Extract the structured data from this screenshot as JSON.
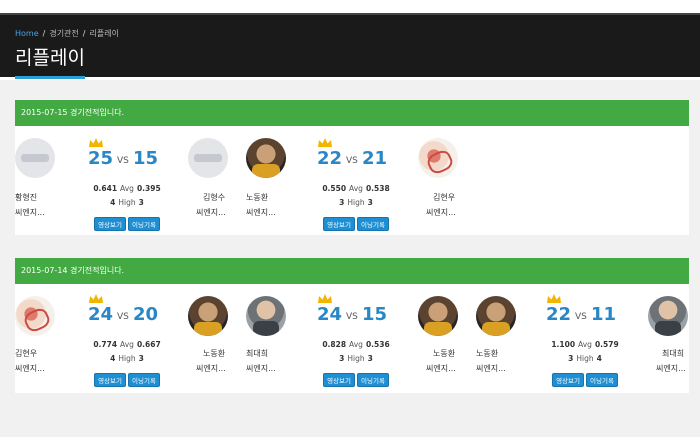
{
  "breadcrumb": [
    "Home",
    "경기관전",
    "리플레이"
  ],
  "page_title": "리플레이",
  "sections": [
    {
      "date_label": "2015-07-15 경기전적입니다.",
      "matches": [
        {
          "left": {
            "name": "황형진",
            "team": "씨엔지..."
          },
          "right": {
            "name": "김형수",
            "team": "씨엔지..."
          },
          "score_left": "25",
          "score_right": "15",
          "avg_left": "0.641",
          "avg_right": "0.395",
          "high_left": "4",
          "high_right": "3",
          "winner": "left"
        },
        {
          "left": {
            "name": "노동환",
            "team": "씨엔지..."
          },
          "right": {
            "name": "김현우",
            "team": "씨엔지..."
          },
          "score_left": "22",
          "score_right": "21",
          "avg_left": "0.550",
          "avg_right": "0.538",
          "high_left": "3",
          "high_right": "3",
          "winner": "left"
        }
      ]
    },
    {
      "date_label": "2015-07-14 경기전적입니다.",
      "matches": [
        {
          "left": {
            "name": "김현우",
            "team": "씨엔지..."
          },
          "right": {
            "name": "노동환",
            "team": "씨엔지..."
          },
          "score_left": "24",
          "score_right": "20",
          "avg_left": "0.774",
          "avg_right": "0.667",
          "high_left": "4",
          "high_right": "3",
          "winner": "left"
        },
        {
          "left": {
            "name": "최대희",
            "team": "씨엔지..."
          },
          "right": {
            "name": "노동환",
            "team": "씨엔지..."
          },
          "score_left": "24",
          "score_right": "15",
          "avg_left": "0.828",
          "avg_right": "0.536",
          "high_left": "3",
          "high_right": "3",
          "winner": "left"
        },
        {
          "left": {
            "name": "노동환",
            "team": "씨엔지..."
          },
          "right": {
            "name": "최대희",
            "team": "씨엔지..."
          },
          "score_left": "22",
          "score_right": "11",
          "avg_left": "1.100",
          "avg_right": "0.579",
          "high_left": "3",
          "high_right": "4",
          "winner": "left"
        }
      ]
    }
  ],
  "labels": {
    "avg": "Avg",
    "high": "High",
    "vs": "VS",
    "video_button": "영상보기",
    "record_button": "이닝기록"
  },
  "colors": {
    "header_bg": "#1a1a1a",
    "section_bar": "#43a943",
    "score_blue": "#2a87c6",
    "button_blue": "#1f8fd3",
    "crown": "#f2b600"
  }
}
